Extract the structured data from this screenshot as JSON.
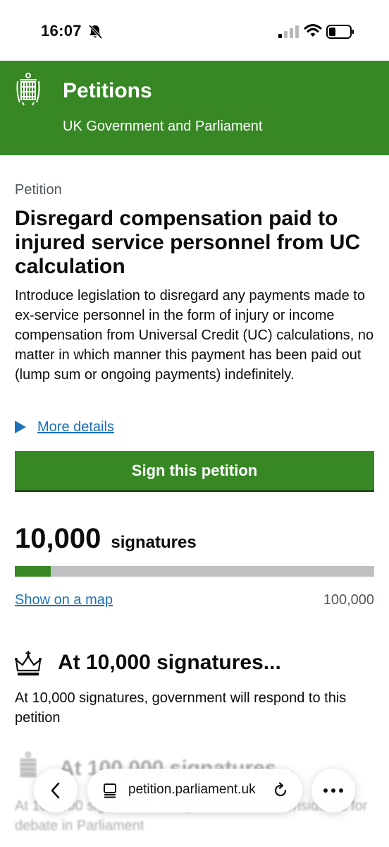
{
  "status_bar": {
    "time": "16:07",
    "icons": [
      "bell-slash-icon",
      "signal-icon",
      "wifi-icon",
      "battery-icon"
    ]
  },
  "header": {
    "title": "Petitions",
    "subtitle": "UK Government and Parliament",
    "logo": "portcullis-icon",
    "background": "#378825"
  },
  "petition": {
    "caption": "Petition",
    "title": "Disregard compensation paid to injured service personnel from UC calculation",
    "body": "Introduce legislation to disregard any payments made to ex-service personnel in the form of injury or income compensation from Universal Credit (UC) calculations, no matter in which manner this payment has been paid out (lump sum or ongoing payments) indefinitely.",
    "more_details": "More details"
  },
  "sign_button": {
    "label": "Sign this petition"
  },
  "signatures": {
    "count": "10,000",
    "label": "signatures",
    "progress_fraction": 0.1,
    "map_link": "Show on a map",
    "target": "100,000"
  },
  "milestones": [
    {
      "icon": "crown-icon",
      "title": "At 10,000 signatures...",
      "text": "At 10,000 signatures, government will respond to this petition"
    },
    {
      "icon": "portcullis-icon",
      "title": "At 100,000 signatures...",
      "text": "At 100,000 signatures, this petition will be considered for debate in Parliament"
    }
  ],
  "browser": {
    "url": "petition.parliament.uk",
    "icons": [
      "back-chevron-icon",
      "tabs-icon",
      "reload-icon",
      "more-dots-icon"
    ]
  },
  "colors": {
    "green": "#378825",
    "link": "#1d70b8",
    "progress_track": "#bfc1c3",
    "secondary_text": "#505a5f"
  }
}
